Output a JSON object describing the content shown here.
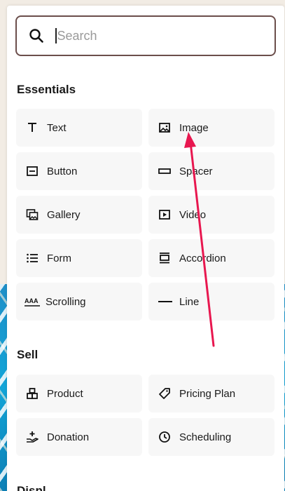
{
  "search": {
    "placeholder": "Search"
  },
  "sections": {
    "essentials": "Essentials",
    "sell": "Sell",
    "display_partial": "Displ"
  },
  "essentials": {
    "text": "Text",
    "image": "Image",
    "button": "Button",
    "spacer": "Spacer",
    "gallery": "Gallery",
    "video": "Video",
    "form": "Form",
    "accordion": "Accordion",
    "scrolling": "Scrolling",
    "line": "Line"
  },
  "sell": {
    "product": "Product",
    "pricing_plan": "Pricing Plan",
    "donation": "Donation",
    "scheduling": "Scheduling"
  },
  "icons": {
    "scrolling_glyph": "AAA"
  },
  "colors": {
    "search_border": "#6b4e4b",
    "tile_bg": "#f7f7f7",
    "arrow": "#e8174f"
  }
}
